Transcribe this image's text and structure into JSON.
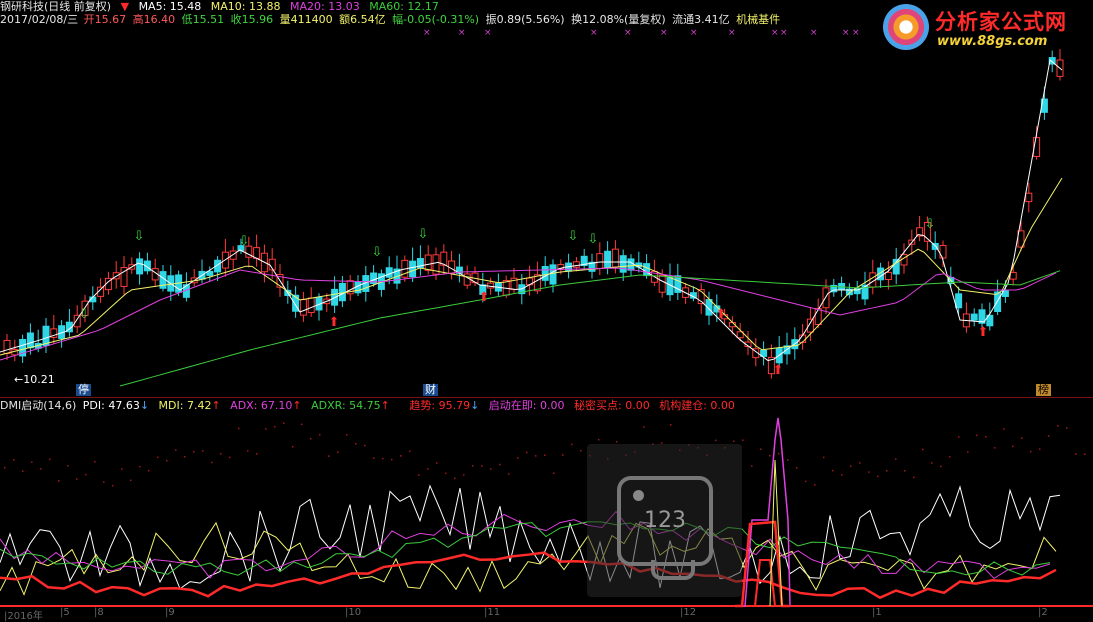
{
  "header": {
    "stock": "钢研科技(日线 前复权)",
    "ma5": "MA5: 15.48",
    "ma10": "MA10: 13.88",
    "ma20": "MA20: 13.03",
    "ma60": "MA60: 12.17",
    "date": "2017/02/08/三",
    "open": "开15.67",
    "high": "高16.40",
    "low": "低15.51",
    "close": "收15.96",
    "volume": "量411400",
    "amount": "额6.54亿",
    "change": "幅-0.05(-0.31%)",
    "amplitude": "振0.89(5.56%)",
    "turnover": "换12.08%(量复权)",
    "float": "流通3.41亿",
    "sector": "机械基件"
  },
  "watermark": {
    "title": "分析家公式网",
    "url": "www.88gs.com"
  },
  "price_panel": {
    "low_label": "10.21",
    "tags": [
      "停",
      "财",
      "榜"
    ]
  },
  "indicator": {
    "name": "DMI启动(14,6)",
    "pdi": "PDI: 47.63",
    "mdi": "MDI: 7.42",
    "adx": "ADX: 67.10",
    "adxr": "ADXR: 54.75",
    "trend": "趋势: 95.79",
    "start": "启动在即: 0.00",
    "secret": "秘密买点: 0.00",
    "inst": "机构建仓: 0.00"
  },
  "overlay": {
    "number": "123"
  },
  "x_axis": [
    "2016年",
    "5",
    "8",
    "9",
    "10",
    "11",
    "12",
    "1",
    "2"
  ],
  "colors": {
    "up": "#ff3b3b",
    "down": "#2fd6e6",
    "ma5": "#ffffff",
    "ma10": "#f3f36a",
    "ma20": "#e040e0",
    "ma60": "#3ccc3c",
    "signal_green": "#3fd63f",
    "signal_red": "#ff2a2a"
  }
}
